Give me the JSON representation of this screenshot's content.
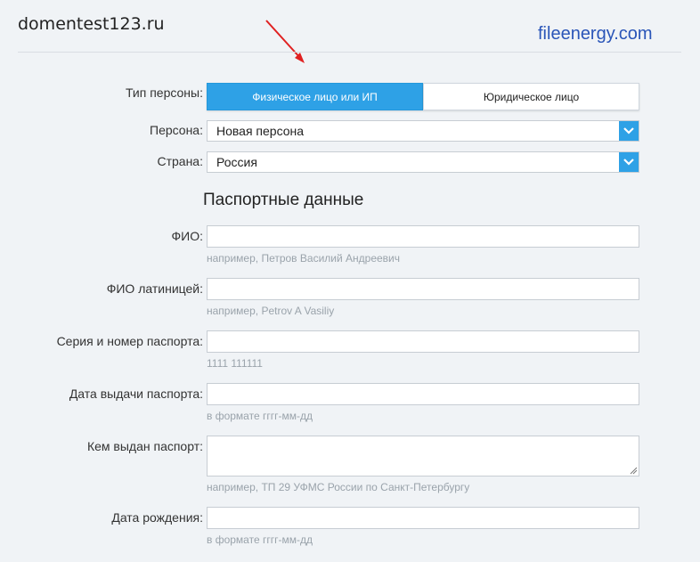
{
  "header": {
    "site_title": "domentest123.ru",
    "watermark": "fileenergy.com"
  },
  "colors": {
    "accent": "#2ea1e6",
    "annotation_arrow": "#e02020",
    "watermark": "#2a55b8"
  },
  "person_type": {
    "label": "Тип персоны:",
    "options": [
      "Физическое лицо или ИП",
      "Юридическое лицо"
    ],
    "selected": "Физическое лицо или ИП"
  },
  "persona": {
    "label": "Персона:",
    "value": "Новая персона"
  },
  "country": {
    "label": "Страна:",
    "value": "Россия"
  },
  "passport_section": {
    "title": "Паспортные данные",
    "fields": [
      {
        "label": "ФИО:",
        "value": "",
        "hint": "например, Петров Василий Андреевич"
      },
      {
        "label": "ФИО латиницей:",
        "value": "",
        "hint": "например, Petrov A Vasiliy"
      },
      {
        "label": "Серия и номер паспорта:",
        "value": "",
        "hint": "1111 111111"
      },
      {
        "label": "Дата выдачи паспорта:",
        "value": "",
        "hint": "в формате гггг-мм-дд"
      },
      {
        "label": "Кем выдан паспорт:",
        "value": "",
        "hint": "например, ТП 29 УФМС России по Санкт-Петербургу"
      },
      {
        "label": "Дата рождения:",
        "value": "",
        "hint": "в формате гггг-мм-дд"
      }
    ]
  }
}
